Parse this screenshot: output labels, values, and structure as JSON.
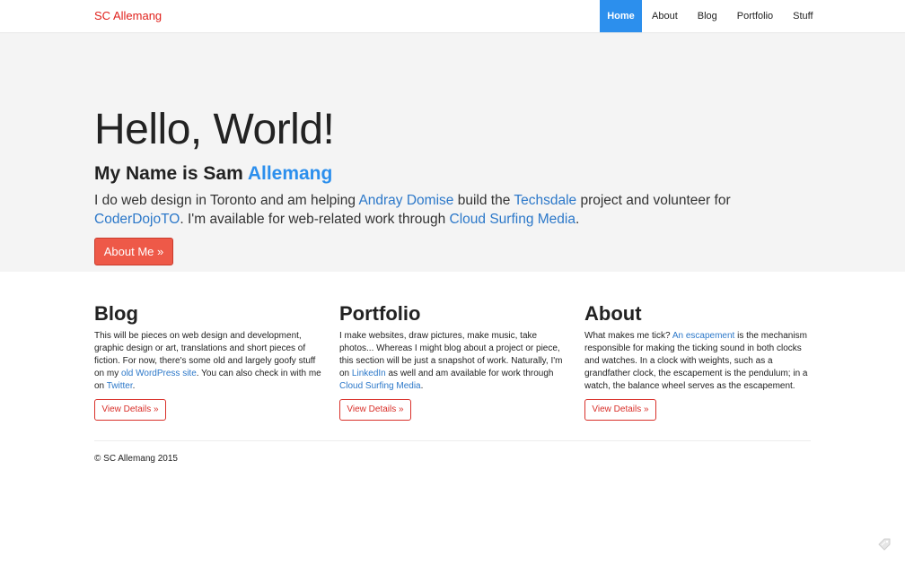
{
  "navbar": {
    "brand": "SC Allemang",
    "items": [
      {
        "label": "Home",
        "active": true
      },
      {
        "label": "About",
        "active": false
      },
      {
        "label": "Blog",
        "active": false
      },
      {
        "label": "Portfolio",
        "active": false
      },
      {
        "label": "Stuff",
        "active": false
      }
    ]
  },
  "hero": {
    "title": "Hello, World!",
    "subtitle_prefix": "My Name is Sam ",
    "subtitle_accent": "Allemang",
    "text": {
      "t1": "I do web design in Toronto and am helping ",
      "link1": "Andray Domise",
      "t2": " build the ",
      "link2": "Techsdale",
      "t3": " project and volunteer for ",
      "link3": "CoderDojoTO",
      "t4": ". I'm available for web-related work through ",
      "link4": "Cloud Surfing Media",
      "t5": "."
    },
    "button": "About Me »"
  },
  "columns": [
    {
      "title": "Blog",
      "t1": "This will be pieces on web design and development, graphic design or art, translations and short pieces of fiction. For now, there's some old and largely goofy stuff on my ",
      "link1": "old WordPress site",
      "t2": ". You can also check in with me on ",
      "link2": "Twitter",
      "t3": ".",
      "button": "View Details »"
    },
    {
      "title": "Portfolio",
      "t1": "I make websites, draw pictures, make music, take photos... Whereas I might blog about a project or piece, this section will be just a snapshot of work. Naturally, I'm on ",
      "link1": "LinkedIn",
      "t2": " as well and am available for work through ",
      "link2": "Cloud Surfing Media",
      "t3": ".",
      "button": "View Details »"
    },
    {
      "title": "About",
      "t1": "What makes me tick? ",
      "link1": "An escapement",
      "t2": " is the mechanism responsible for making the ticking sound in both clocks and watches. In a clock with weights, such as a grandfather clock, the escapement is the pendulum; in a watch, the balance wheel serves as the escapement.",
      "link2": "",
      "t3": "",
      "button": "View Details »"
    }
  ],
  "footer": {
    "copyright": "© SC Allemang 2015"
  },
  "colors": {
    "brand": "#e0211c",
    "nav_active": "#2c8fed",
    "link": "#2c78c9",
    "primary_button": "#ee5948",
    "outline_button": "#d9302a",
    "hero_bg": "#f4f4f4"
  },
  "icons": {
    "corner": "tag-icon"
  }
}
